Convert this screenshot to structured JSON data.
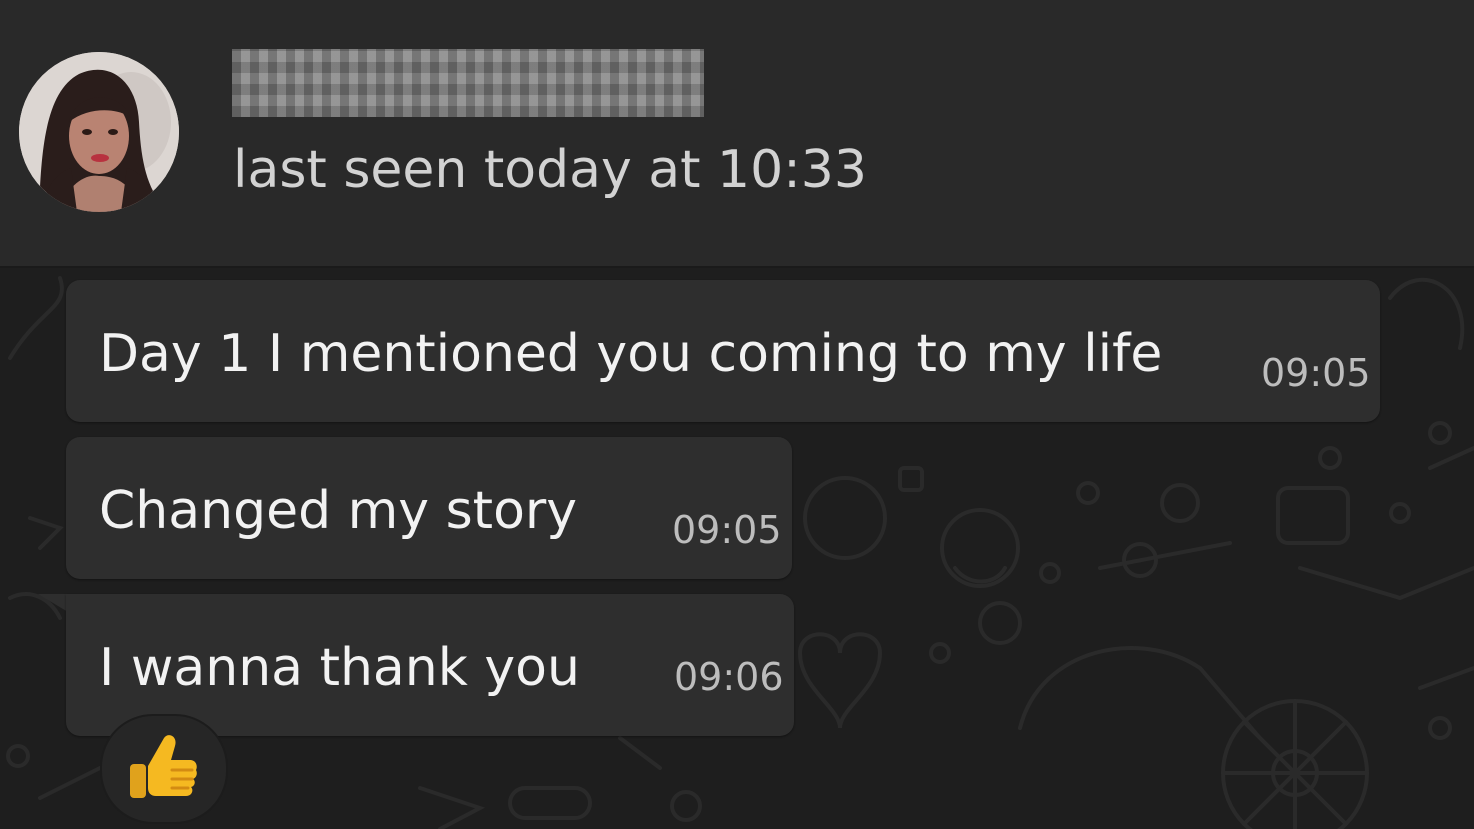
{
  "header": {
    "contact_name": "",
    "status": "last seen today at 10:33"
  },
  "messages": [
    {
      "text": "Day 1 I mentioned you coming to my life",
      "time": "09:05"
    },
    {
      "text": "Changed my story",
      "time": "09:05"
    },
    {
      "text": "I wanna thank you",
      "time": "09:06",
      "reaction": "thumbs-up-icon"
    }
  ],
  "colors": {
    "header_bg": "#292929",
    "chat_bg": "#1e1e1e",
    "bubble_bg": "#2e2e2e",
    "text": "#f2f2f2",
    "timestamp": "#bdbdbd",
    "reaction_emoji": "#f5b921"
  }
}
